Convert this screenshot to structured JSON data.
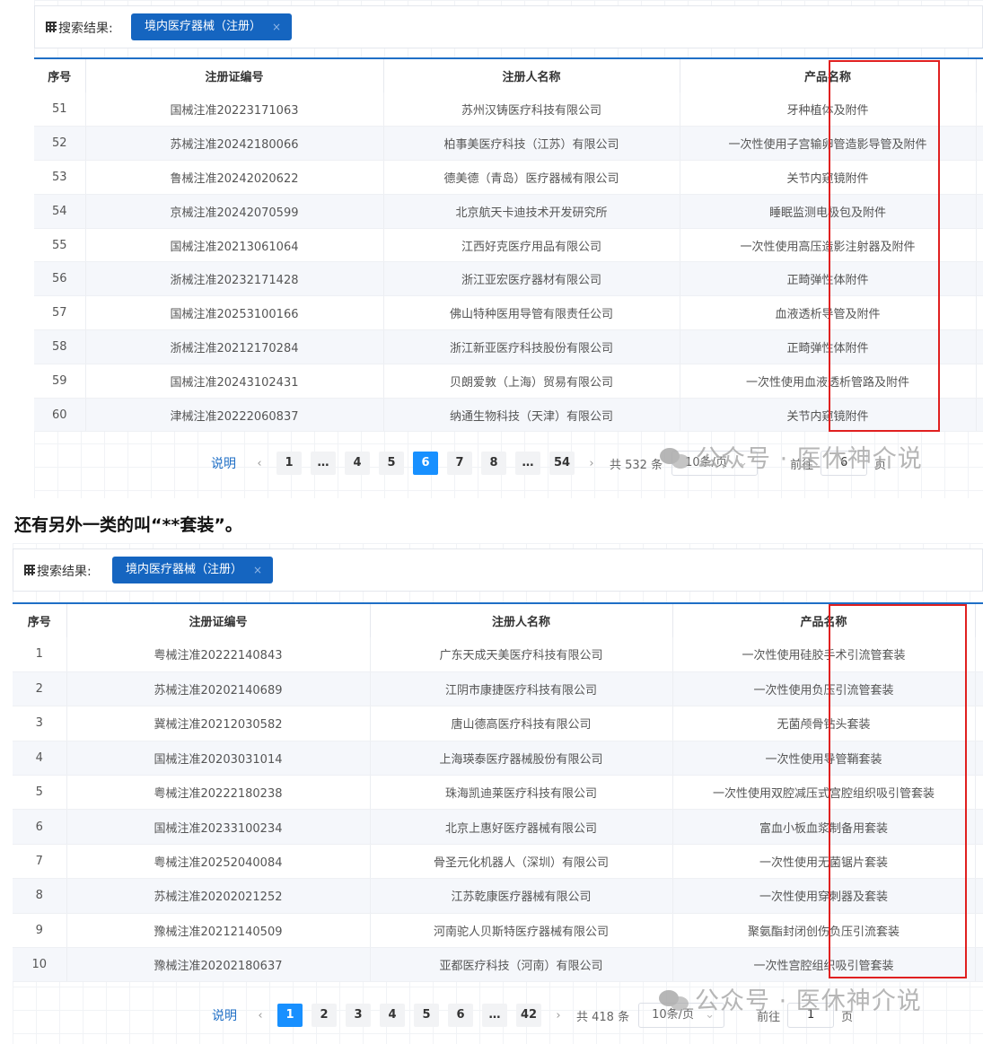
{
  "panel1": {
    "search": {
      "label": "搜索结果:",
      "tag": "境内医疗器械（注册）",
      "tag_close": "×"
    },
    "columns": [
      "序号",
      "注册证编号",
      "注册人名称",
      "产品名称"
    ],
    "rows": [
      [
        "51",
        "国械注准20223171063",
        "苏州汉铸医疗科技有限公司",
        "牙种植体及附件"
      ],
      [
        "52",
        "苏械注准20242180066",
        "柏事美医疗科技（江苏）有限公司",
        "一次性使用子宫输卵管造影导管及附件"
      ],
      [
        "53",
        "鲁械注准20242020622",
        "德美德（青岛）医疗器械有限公司",
        "关节内窥镜附件"
      ],
      [
        "54",
        "京械注准20242070599",
        "北京航天卡迪技术开发研究所",
        "睡眠监测电极包及附件"
      ],
      [
        "55",
        "国械注准20213061064",
        "江西好克医疗用品有限公司",
        "一次性使用高压造影注射器及附件"
      ],
      [
        "56",
        "浙械注准20232171428",
        "浙江亚宏医疗器材有限公司",
        "正畸弹性体附件"
      ],
      [
        "57",
        "国械注准20253100166",
        "佛山特种医用导管有限责任公司",
        "血液透析导管及附件"
      ],
      [
        "58",
        "浙械注准20212170284",
        "浙江新亚医疗科技股份有限公司",
        "正畸弹性体附件"
      ],
      [
        "59",
        "国械注准20243102431",
        "贝朗爱敦（上海）贸易有限公司",
        "一次性使用血液透析管路及附件"
      ],
      [
        "60",
        "津械注准20222060837",
        "纳通生物科技（天津）有限公司",
        "关节内窥镜附件"
      ]
    ],
    "pager": {
      "note": "说明",
      "prev": "‹",
      "next": "›",
      "pages": [
        "1",
        "…",
        "4",
        "5",
        "6",
        "7",
        "8",
        "…",
        "54"
      ],
      "active_index": 4,
      "total": "共 532 条",
      "size": "10条/页",
      "goto": "前往",
      "goto_value": "6",
      "page_suffix": "页"
    }
  },
  "caption": "还有另外一类的叫“**套装”。",
  "panel2": {
    "search": {
      "label": "搜索结果:",
      "tag": "境内医疗器械（注册）",
      "tag_close": "×"
    },
    "columns": [
      "序号",
      "注册证编号",
      "注册人名称",
      "产品名称"
    ],
    "rows": [
      [
        "1",
        "粤械注准20222140843",
        "广东天成天美医疗科技有限公司",
        "一次性使用硅胶手术引流管套装"
      ],
      [
        "2",
        "苏械注准20202140689",
        "江阴市康捷医疗科技有限公司",
        "一次性使用负压引流管套装"
      ],
      [
        "3",
        "冀械注准20212030582",
        "唐山德高医疗科技有限公司",
        "无菌颅骨钻头套装"
      ],
      [
        "4",
        "国械注准20203031014",
        "上海瑛泰医疗器械股份有限公司",
        "一次性使用导管鞘套装"
      ],
      [
        "5",
        "粤械注准20222180238",
        "珠海凯迪莱医疗科技有限公司",
        "一次性使用双腔减压式宫腔组织吸引管套装"
      ],
      [
        "6",
        "国械注准20233100234",
        "北京上惠好医疗器械有限公司",
        "富血小板血浆制备用套装"
      ],
      [
        "7",
        "粤械注准20252040084",
        "骨圣元化机器人（深圳）有限公司",
        "一次性使用无菌锯片套装"
      ],
      [
        "8",
        "苏械注准20202021252",
        "江苏乾康医疗器械有限公司",
        "一次性使用穿刺器及套装"
      ],
      [
        "9",
        "豫械注准20212140509",
        "河南驼人贝斯特医疗器械有限公司",
        "聚氨酯封闭创伤负压引流套装"
      ],
      [
        "10",
        "豫械注准20202180637",
        "亚都医疗科技（河南）有限公司",
        "一次性宫腔组织吸引管套装"
      ]
    ],
    "pager": {
      "note": "说明",
      "prev": "‹",
      "next": "›",
      "pages": [
        "1",
        "2",
        "3",
        "4",
        "5",
        "6",
        "…",
        "42"
      ],
      "active_index": 0,
      "total": "共 418 条",
      "size": "10条/页",
      "goto": "前往",
      "goto_value": "1",
      "page_suffix": "页"
    }
  },
  "watermark": "公众号 · 医休神介说",
  "colors": {
    "accent": "#1565c0",
    "active_page": "#1890ff",
    "highlight_box": "#e02020",
    "header_rule": "#1f6fc6"
  }
}
